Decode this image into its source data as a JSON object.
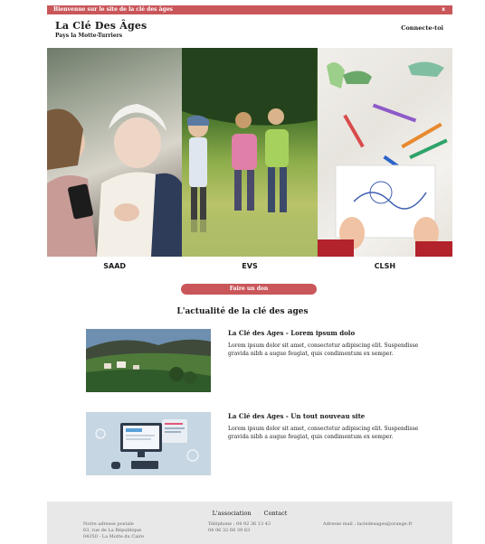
{
  "banner": {
    "message": "Bienvenue sur le site de la clé des âges",
    "close": "x"
  },
  "header": {
    "title": "La Clé Des Âges",
    "subtitle": "Pays la Motte-Turriers",
    "login": "Connecte-toi"
  },
  "hero": {
    "panels": [
      {
        "label": "SAAD",
        "image": "elderly-woman-with-caregiver-photo"
      },
      {
        "label": "EVS",
        "image": "family-walking-in-meadow-photo"
      },
      {
        "label": "CLSH",
        "image": "children-drawing-with-crayons-photo"
      }
    ]
  },
  "donate_label": "Faire un don",
  "news": {
    "title": "L'actualité de la clé des ages",
    "items": [
      {
        "title": "La Clé des Ages - Lorem ipsum dolo",
        "text": "Lorem ipsum dolor sit amet, consectetur adipiscing elit. Suspendisse gravida nibh a augue feugiat, quis condimentum ex semper."
      },
      {
        "title": "La Clé des Ages - Un tout nouveau site",
        "text": "Lorem ipsum dolor sit amet, consectetur adipiscing elit. Suspendisse gravida nibh a augue feugiat, quis condimentum ex semper."
      }
    ]
  },
  "footer": {
    "association": "L'association",
    "contact": "Contact",
    "address": [
      "Notre adresse postale",
      "63, rue de La République",
      "04350 - La Motte du Caire"
    ],
    "phones": [
      "Téléphone : 04 92 36 13 43",
      "04 06 32 68 39 83"
    ],
    "email": "Adresse mail : lacledesages@orange.fr"
  },
  "colors": {
    "accent": "#c9575a",
    "footer_bg": "#e8e8e8"
  }
}
